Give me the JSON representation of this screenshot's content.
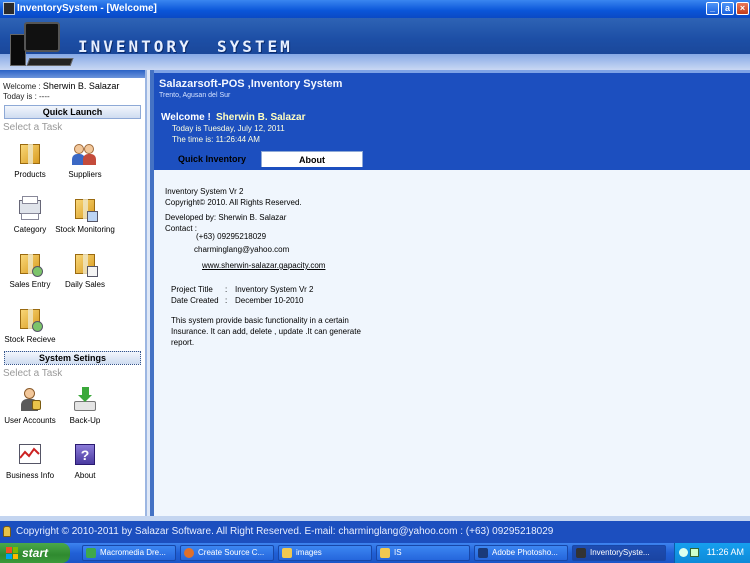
{
  "window": {
    "title": "InventorySystem - [Welcome]",
    "controls": {
      "minimize": "_",
      "maximize": "a",
      "close": "×"
    }
  },
  "banner": {
    "logo_text": "INVENTORY  SYSTEM"
  },
  "sidebar": {
    "welcome_line": "Welcome : ",
    "welcome_name": "Sherwin B. Salazar",
    "today_line": "Today is : ----",
    "quick_launch_title": "Quick Launch",
    "select_task": "Select a Task",
    "quick_items": [
      {
        "label": "Products",
        "icon": "products-icon"
      },
      {
        "label": "Suppliers",
        "icon": "suppliers-icon"
      },
      {
        "label": "Category",
        "icon": "category-icon"
      },
      {
        "label": "Stock Monitoring",
        "icon": "stock-monitoring-icon"
      },
      {
        "label": "Sales Entry",
        "icon": "sales-entry-icon"
      },
      {
        "label": "Daily Sales",
        "icon": "daily-sales-icon"
      },
      {
        "label": "Stock Recieve",
        "icon": "stock-recieve-icon"
      }
    ],
    "system_settings_title": "System Setings",
    "select_task_2": "Select a Task",
    "system_items": [
      {
        "label": "User Accounts",
        "icon": "user-accounts-icon"
      },
      {
        "label": "Back-Up",
        "icon": "backup-icon"
      },
      {
        "label": "Business Info",
        "icon": "business-info-icon"
      },
      {
        "label": "About",
        "icon": "about-icon"
      }
    ]
  },
  "header": {
    "app_title": "Salazarsoft-POS ,Inventory System",
    "location": "Trento, Agusan del Sur",
    "welcome_label": "Welcome !",
    "welcome_name": "Sherwin B. Salazar",
    "date_line": "Today is Tuesday, July 12, 2011",
    "time_line": "The time is: 11:26:44 AM",
    "tabs": [
      {
        "label": "Quick Inventory",
        "active": false
      },
      {
        "label": "About",
        "active": true
      }
    ]
  },
  "about": {
    "version": "Inventory System Vr 2",
    "copyright": "Copyright© 2010. All Rights Reserved.",
    "developer": "Developed by: Sherwin B. Salazar",
    "contact_label": "Contact :",
    "phone": "(+63) 09295218029",
    "email": "charminglang@yahoo.com",
    "website": "www.sherwin-salazar.gapacity.com",
    "project_title_label": "Project Title",
    "project_title_value": "Inventory System Vr 2",
    "date_created_label": "Date Created",
    "date_created_value": "December 10-2010",
    "separator": ":",
    "description": "This system provide basic functionality in a certain Insurance. It can add,  delete , update .It can generate report."
  },
  "status_bar": {
    "copyright": "Copyright © 2010-2011 by Salazar Software. All Right Reserved. E-mail: charminglang@yahoo.com : (+63) 09295218029"
  },
  "taskbar": {
    "start_label": "start",
    "items": [
      {
        "label": "Macromedia Dre...",
        "color": "#3fa84a"
      },
      {
        "label": "Create Source C...",
        "color": "#e0702a"
      },
      {
        "label": "images",
        "color": "#f0c850"
      },
      {
        "label": "IS",
        "color": "#f0c850"
      },
      {
        "label": "Adobe Photosho...",
        "color": "#1a3a7a"
      },
      {
        "label": "InventorySyste...",
        "color": "#333333"
      }
    ],
    "clock": "11:26 AM"
  },
  "colors": {
    "title_bar": "#0a55d8",
    "content_header": "#1c4fbf",
    "content_bg": "#f0f6fd",
    "taskbar": "#2160d6",
    "start_button": "#2f8a2f"
  }
}
